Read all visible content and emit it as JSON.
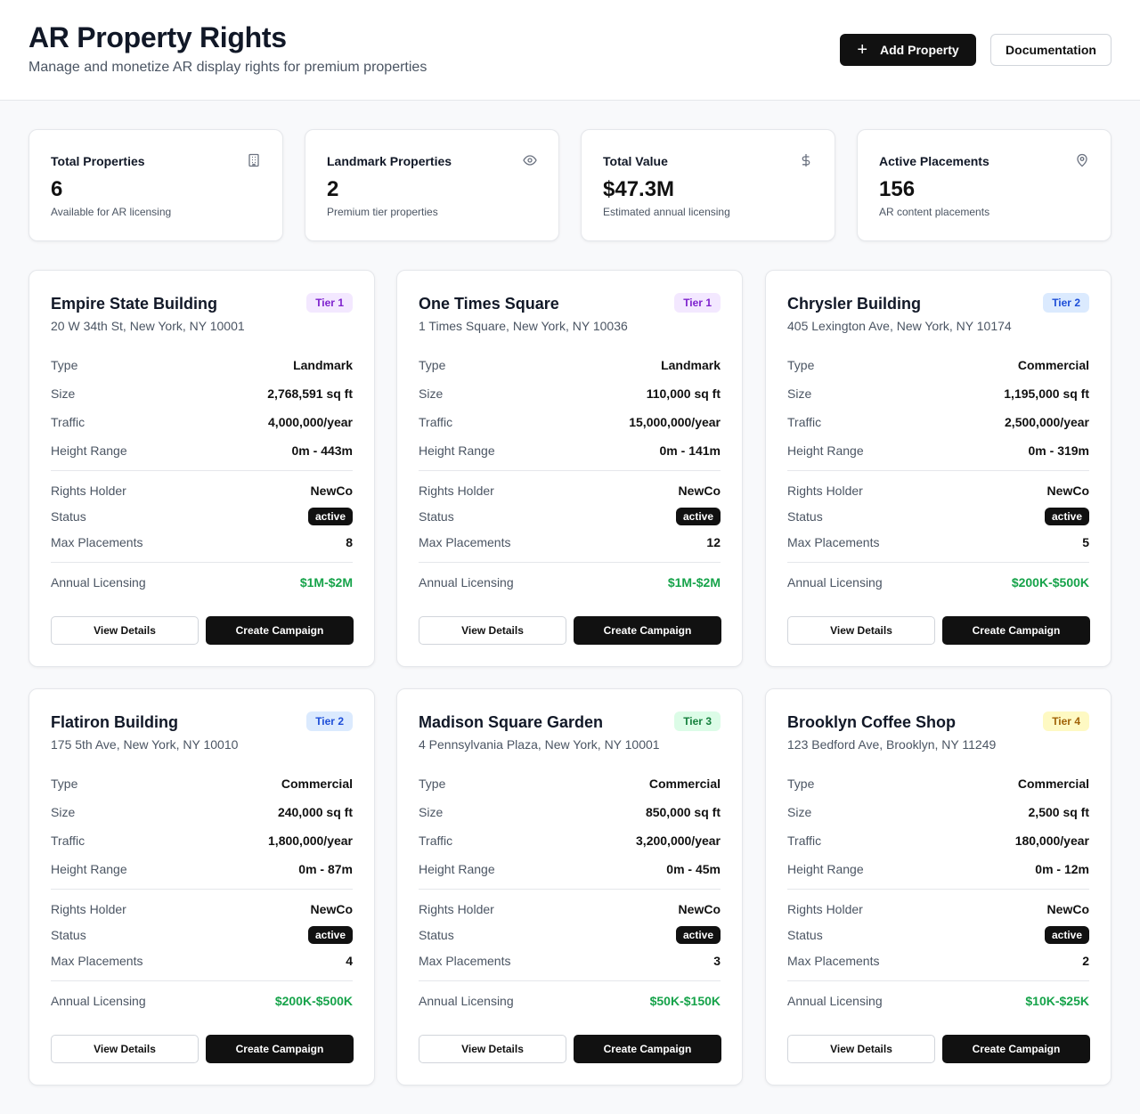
{
  "header": {
    "title": "AR Property Rights",
    "subtitle": "Manage and monetize AR display rights for premium properties",
    "add_label": "Add Property",
    "doc_label": "Documentation"
  },
  "stats": [
    {
      "label": "Total Properties",
      "value": "6",
      "note": "Available for AR licensing",
      "icon": "building-icon"
    },
    {
      "label": "Landmark Properties",
      "value": "2",
      "note": "Premium tier properties",
      "icon": "eye-icon"
    },
    {
      "label": "Total Value",
      "value": "$47.3M",
      "note": "Estimated annual licensing",
      "icon": "dollar-icon"
    },
    {
      "label": "Active Placements",
      "value": "156",
      "note": "AR content placements",
      "icon": "map-pin-icon"
    }
  ],
  "labels": {
    "type": "Type",
    "size": "Size",
    "traffic": "Traffic",
    "height": "Height Range",
    "holder": "Rights Holder",
    "status": "Status",
    "max": "Max Placements",
    "licensing": "Annual Licensing",
    "view": "View Details",
    "create": "Create Campaign"
  },
  "properties": [
    {
      "name": "Empire State Building",
      "address": "20 W 34th St, New York, NY 10001",
      "tier": "Tier 1",
      "type": "Landmark",
      "size": "2,768,591 sq ft",
      "traffic": "4,000,000/year",
      "height": "0m - 443m",
      "holder": "NewCo",
      "status": "active",
      "max": "8",
      "licensing": "$1M-$2M"
    },
    {
      "name": "One Times Square",
      "address": "1 Times Square, New York, NY 10036",
      "tier": "Tier 1",
      "type": "Landmark",
      "size": "110,000 sq ft",
      "traffic": "15,000,000/year",
      "height": "0m - 141m",
      "holder": "NewCo",
      "status": "active",
      "max": "12",
      "licensing": "$1M-$2M"
    },
    {
      "name": "Chrysler Building",
      "address": "405 Lexington Ave, New York, NY 10174",
      "tier": "Tier 2",
      "type": "Commercial",
      "size": "1,195,000 sq ft",
      "traffic": "2,500,000/year",
      "height": "0m - 319m",
      "holder": "NewCo",
      "status": "active",
      "max": "5",
      "licensing": "$200K-$500K"
    },
    {
      "name": "Flatiron Building",
      "address": "175 5th Ave, New York, NY 10010",
      "tier": "Tier 2",
      "type": "Commercial",
      "size": "240,000 sq ft",
      "traffic": "1,800,000/year",
      "height": "0m - 87m",
      "holder": "NewCo",
      "status": "active",
      "max": "4",
      "licensing": "$200K-$500K"
    },
    {
      "name": "Madison Square Garden",
      "address": "4 Pennsylvania Plaza, New York, NY 10001",
      "tier": "Tier 3",
      "type": "Commercial",
      "size": "850,000 sq ft",
      "traffic": "3,200,000/year",
      "height": "0m - 45m",
      "holder": "NewCo",
      "status": "active",
      "max": "3",
      "licensing": "$50K-$150K"
    },
    {
      "name": "Brooklyn Coffee Shop",
      "address": "123 Bedford Ave, Brooklyn, NY 11249",
      "tier": "Tier 4",
      "type": "Commercial",
      "size": "2,500 sq ft",
      "traffic": "180,000/year",
      "height": "0m - 12m",
      "holder": "NewCo",
      "status": "active",
      "max": "2",
      "licensing": "$10K-$25K"
    }
  ]
}
